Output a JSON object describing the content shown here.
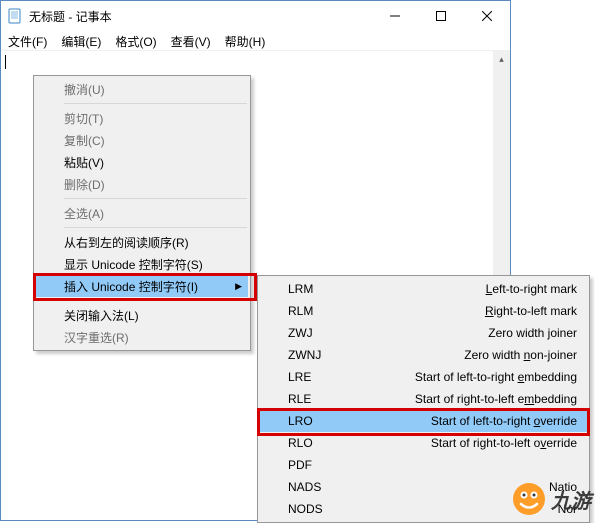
{
  "window": {
    "title": "无标题 - 记事本"
  },
  "menubar": {
    "file": "文件(F)",
    "edit": "编辑(E)",
    "format": "格式(O)",
    "view": "查看(V)",
    "help": "帮助(H)"
  },
  "context_menu": {
    "undo": "撤消(U)",
    "cut": "剪切(T)",
    "copy": "复制(C)",
    "paste": "粘贴(V)",
    "delete": "删除(D)",
    "select_all": "全选(A)",
    "reading_order": "从右到左的阅读顺序(R)",
    "show_unicode": "显示 Unicode 控制字符(S)",
    "insert_unicode": "插入 Unicode 控制字符(I)",
    "close_ime": "关闭输入法(L)",
    "reselect_hanzi": "汉字重选(R)"
  },
  "submenu": {
    "items": [
      {
        "code": "LRM",
        "desc_pre": "",
        "desc_u": "L",
        "desc_post": "eft-to-right mark"
      },
      {
        "code": "RLM",
        "desc_pre": "",
        "desc_u": "R",
        "desc_post": "ight-to-left mark"
      },
      {
        "code": "ZWJ",
        "desc_pre": "Zero width ",
        "desc_u": "j",
        "desc_post": "oiner"
      },
      {
        "code": "ZWNJ",
        "desc_pre": "Zero width ",
        "desc_u": "n",
        "desc_post": "on-joiner"
      },
      {
        "code": "LRE",
        "desc_pre": "Start of left-to-right ",
        "desc_u": "e",
        "desc_post": "mbedding"
      },
      {
        "code": "RLE",
        "desc_pre": "Start of right-to-left e",
        "desc_u": "m",
        "desc_post": "bedding"
      },
      {
        "code": "LRO",
        "desc_pre": "Start of left-to-right ",
        "desc_u": "o",
        "desc_post": "verride"
      },
      {
        "code": "RLO",
        "desc_pre": "Start of right-to-left o",
        "desc_u": "v",
        "desc_post": "erride"
      },
      {
        "code": "PDF",
        "desc_pre": "",
        "desc_u": "",
        "desc_post": ""
      },
      {
        "code": "NADS",
        "desc_pre": "Natio",
        "desc_u": "",
        "desc_post": ""
      },
      {
        "code": "NODS",
        "desc_pre": "Nor",
        "desc_u": "",
        "desc_post": ""
      }
    ]
  },
  "watermark": {
    "text": "九游"
  }
}
